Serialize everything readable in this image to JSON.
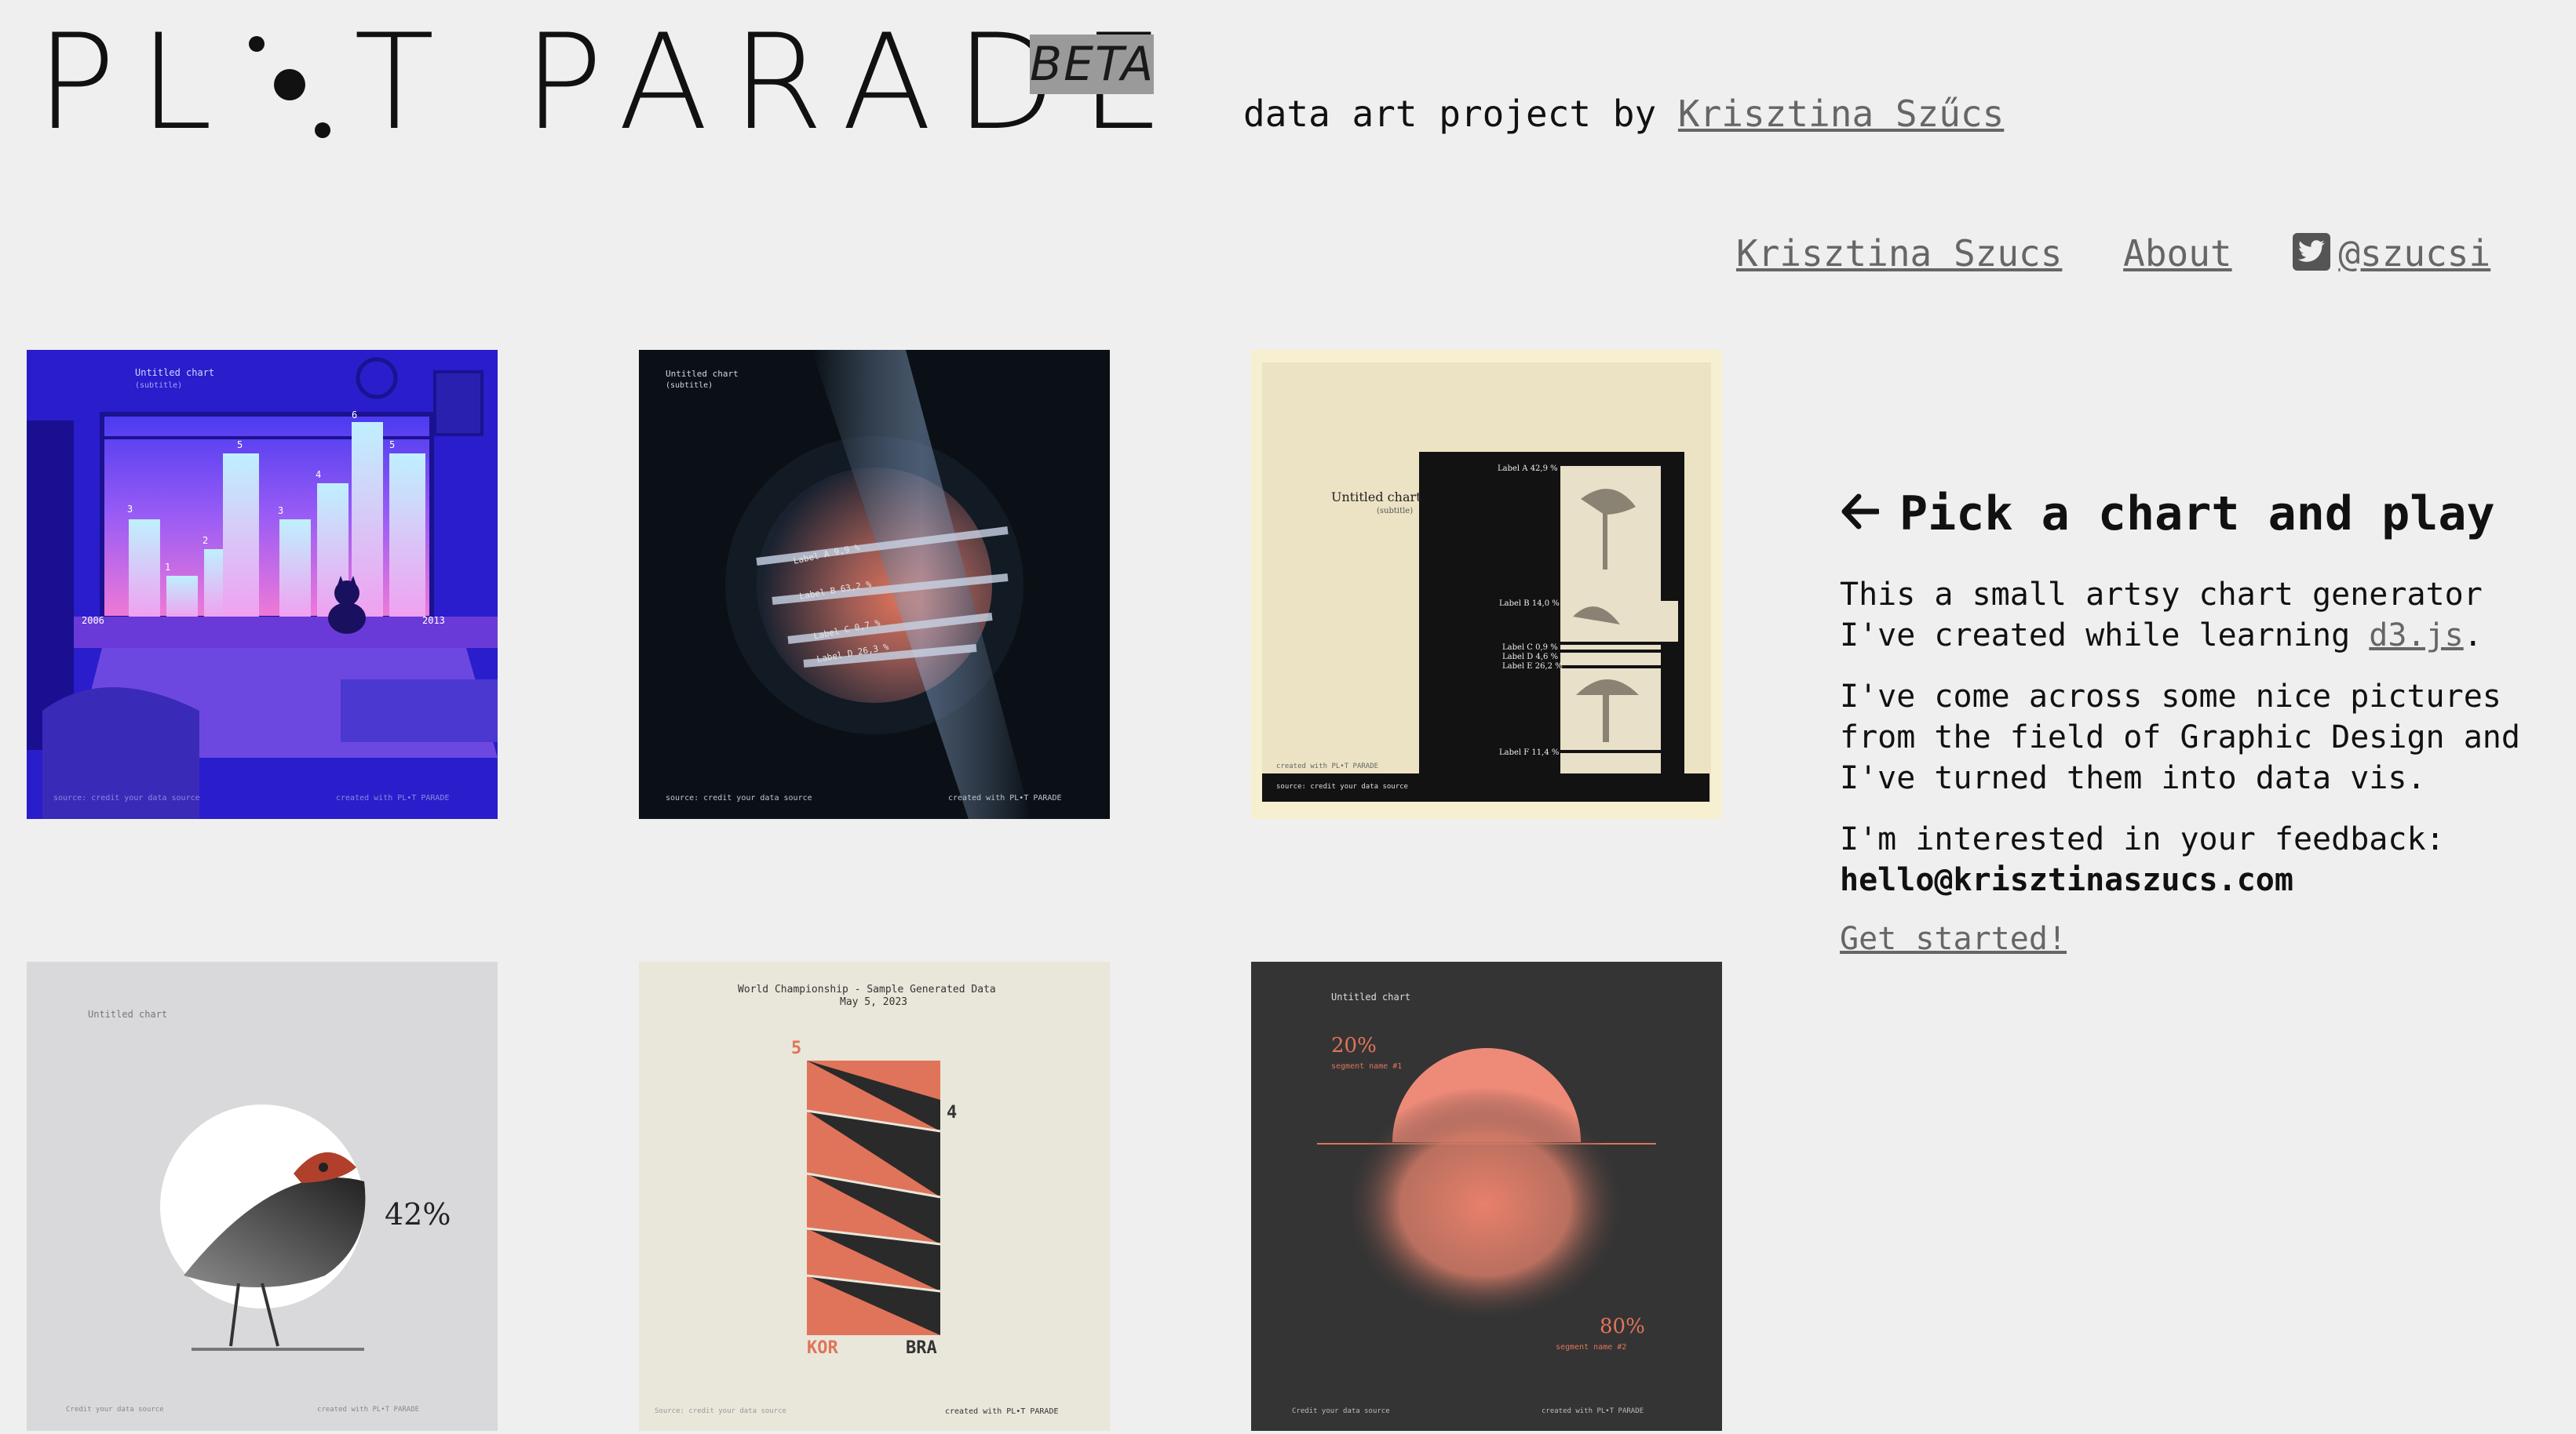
{
  "header": {
    "logo_left": "PL",
    "logo_right": "T PARADE",
    "beta": "BETA",
    "byline_prefix": "data art project by ",
    "byline_author": "Krisztina Szűcs"
  },
  "nav": {
    "author": "Krisztina Szucs",
    "about": "About",
    "twitter_handle": "@szucsi",
    "twitter_icon": "twitter-bird-icon"
  },
  "gallery": {
    "cat_window": {
      "title": "Untitled chart",
      "subtitle": "(subtitle)",
      "year_start": "2006",
      "year_end": "2013",
      "values": [
        "3",
        "1",
        "2",
        "5",
        "3",
        "4",
        "6",
        "5"
      ],
      "source": "source: credit your data source",
      "credit": "created with PL•T PARADE"
    },
    "planet": {
      "title": "Untitled chart",
      "subtitle": "(subtitle)",
      "labels": [
        "Label A 9,9 %",
        "Label B 63,2 %",
        "Label C 0,7 %",
        "Label D 26,3 %"
      ],
      "source": "source: credit your data source",
      "credit": "created with PL•T PARADE"
    },
    "mushrooms": {
      "title": "Untitled chart",
      "subtitle": "(subtitle)",
      "labels": [
        "Label A 42,9 %",
        "Label B 14,0 %",
        "Label C 0,9 %",
        "Label D 4,6 %",
        "Label E 26,2 %",
        "Label F 11,4 %"
      ],
      "source": "source: credit your data source",
      "credit": "created with PL•T PARADE"
    },
    "bird": {
      "title": "Untitled chart",
      "value": "42%",
      "source": "Credit your data source",
      "credit": "created with PL•T PARADE"
    },
    "triangles": {
      "title": "World Championship - Sample Generated Data",
      "date": "May 5, 2023",
      "left_value": "5",
      "right_value": "4",
      "left_team": "KOR",
      "right_team": "BRA",
      "source": "Source: credit your data source",
      "credit": "created with PL•T PARADE"
    },
    "sunset": {
      "title": "Untitled chart",
      "top_value": "20%",
      "top_label": "segment name #1",
      "bottom_value": "80%",
      "bottom_label": "segment name #2",
      "source": "Credit your data source",
      "credit": "created with PL•T PARADE"
    }
  },
  "panel": {
    "heading": "Pick a chart and play",
    "arrow_icon": "arrow-left-icon",
    "p1_text": "This a small artsy chart generator I've created while learning ",
    "p1_link": "d3.js",
    "p1_end": ".",
    "p2": "I've come across some nice pictures from the field of Graphic Design and I've turned them into data vis.",
    "p3": "I'm interested in your feedback:",
    "email": "hello@krisztinaszucs.com",
    "cta": "Get started!"
  },
  "colors": {
    "background": "#efefef",
    "link": "#666666",
    "beta_bg": "#9a9a9a",
    "coral": "#e0745a",
    "cat_blue": "#2a1dcc"
  }
}
